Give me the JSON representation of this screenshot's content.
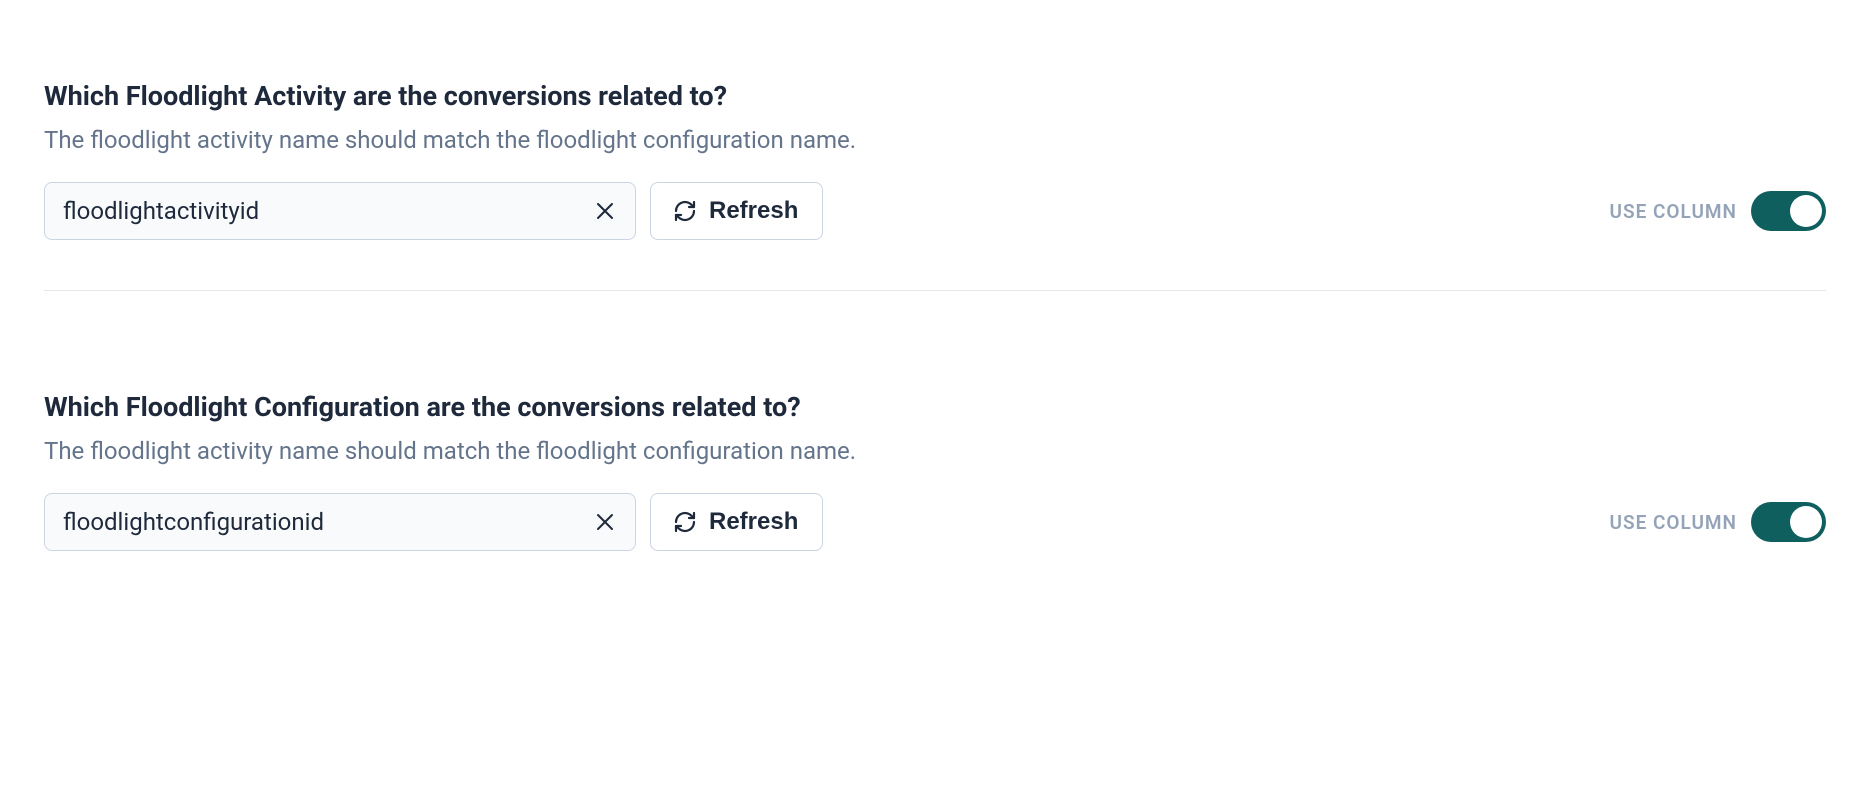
{
  "section1": {
    "heading": "Which Floodlight Activity are the conversions related to?",
    "subtext": "The floodlight activity name should match the floodlight configuration name.",
    "select_value": "floodlightactivityid",
    "refresh_label": "Refresh",
    "toggle_label": "USE COLUMN",
    "toggle_on": true
  },
  "section2": {
    "heading": "Which Floodlight Configuration are the conversions related to?",
    "subtext": "The floodlight activity name should match the floodlight configuration name.",
    "select_value": "floodlightconfigurationid",
    "refresh_label": "Refresh",
    "toggle_label": "USE COLUMN",
    "toggle_on": true
  },
  "colors": {
    "toggle_on_bg": "#0f5f5f",
    "text_primary": "#1e293b",
    "text_muted": "#64748b",
    "border": "#cbd5e1",
    "input_bg": "#f8fafc"
  }
}
